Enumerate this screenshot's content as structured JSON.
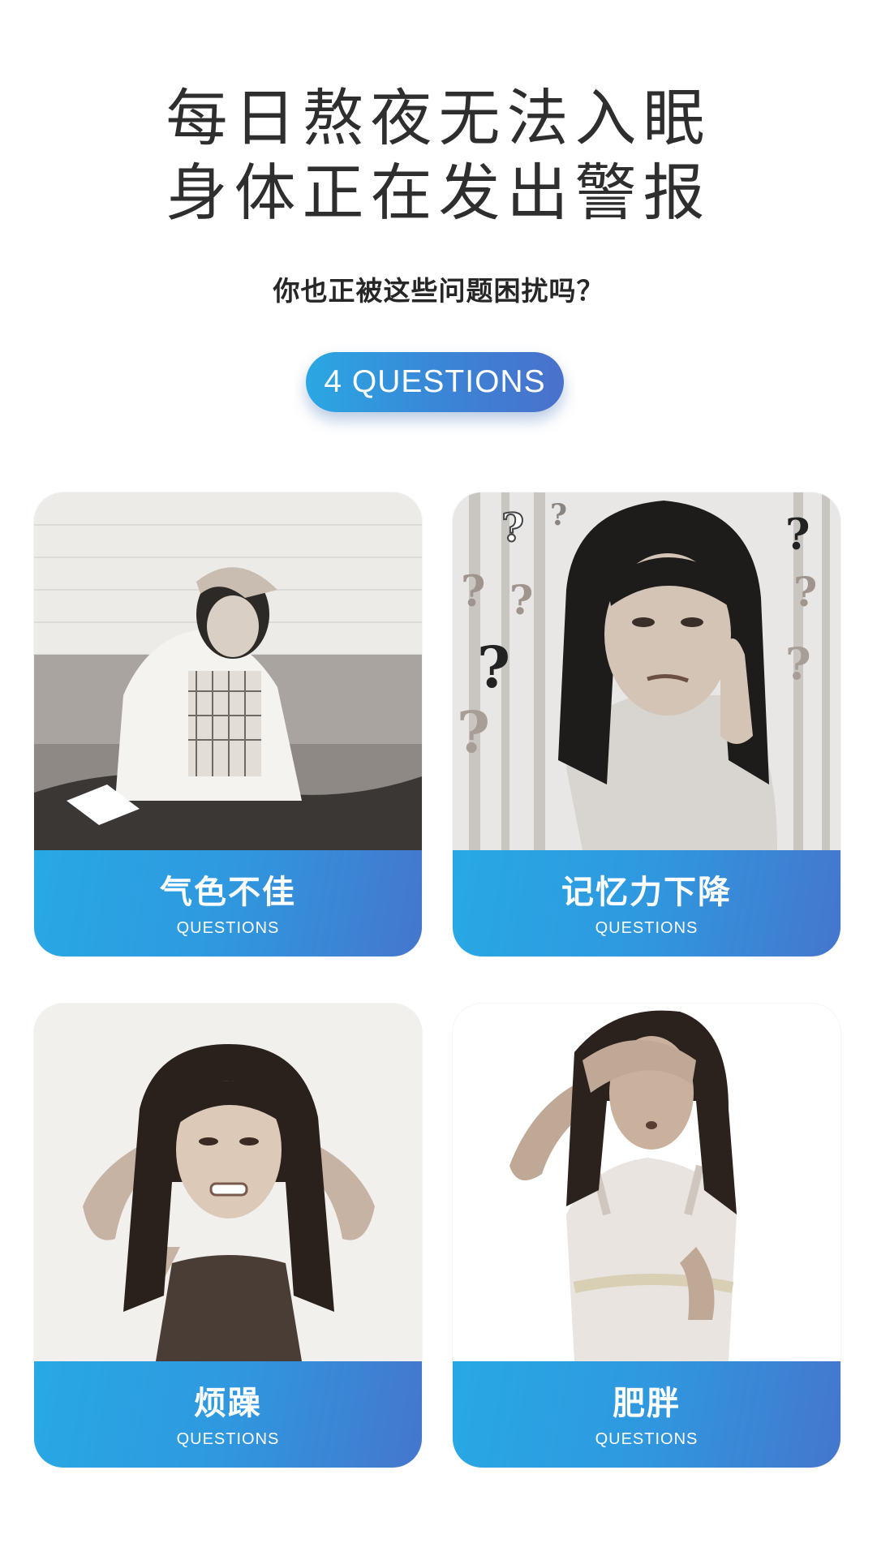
{
  "header": {
    "line1": "每日熬夜无法入眠",
    "line2": "身体正在发出警报",
    "subtitle": "你也正被这些问题困扰吗？",
    "badge": "4 QUESTIONS"
  },
  "cards": [
    {
      "title": "气色不佳",
      "subtitle": "QUESTIONS"
    },
    {
      "title": "记忆力下降",
      "subtitle": "QUESTIONS"
    },
    {
      "title": "烦躁",
      "subtitle": "QUESTIONS"
    },
    {
      "title": "肥胖",
      "subtitle": "QUESTIONS"
    }
  ],
  "colors": {
    "accent_start": "#27a9e4",
    "accent_end": "#4576cd",
    "heading_text": "#2e2e2e"
  }
}
